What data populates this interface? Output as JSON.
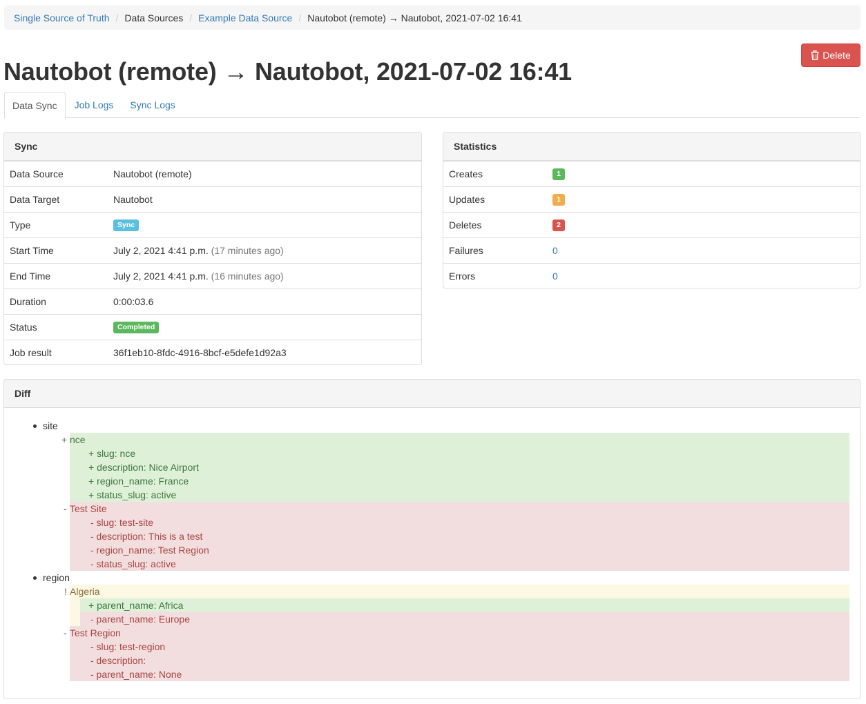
{
  "breadcrumb": {
    "items": [
      "Single Source of Truth",
      "Data Sources",
      "Example Data Source",
      "Nautobot (remote) → Nautobot, 2021-07-02 16:41"
    ]
  },
  "title": "Nautobot (remote) → Nautobot, 2021-07-02 16:41",
  "delete_button": {
    "label": "Delete",
    "icon": "trash-icon"
  },
  "tabs": [
    {
      "label": "Data Sync",
      "active": true
    },
    {
      "label": "Job Logs",
      "active": false
    },
    {
      "label": "Sync Logs",
      "active": false
    }
  ],
  "sync_panel": {
    "heading": "Sync",
    "rows": {
      "data_source": {
        "label": "Data Source",
        "value": "Nautobot (remote)"
      },
      "data_target": {
        "label": "Data Target",
        "value": "Nautobot"
      },
      "type": {
        "label": "Type",
        "value": "Sync"
      },
      "start_time": {
        "label": "Start Time",
        "value": "July 2, 2021 4:41 p.m.",
        "relative": "(17 minutes ago)"
      },
      "end_time": {
        "label": "End Time",
        "value": "July 2, 2021 4:41 p.m.",
        "relative": "(16 minutes ago)"
      },
      "duration": {
        "label": "Duration",
        "value": "0:00:03.6"
      },
      "status": {
        "label": "Status",
        "value": "Completed"
      },
      "job_result": {
        "label": "Job result",
        "value": "36f1eb10-8fdc-4916-8bcf-e5defe1d92a3"
      }
    }
  },
  "stats_panel": {
    "heading": "Statistics",
    "rows": {
      "creates": {
        "label": "Creates",
        "value": "1"
      },
      "updates": {
        "label": "Updates",
        "value": "1"
      },
      "deletes": {
        "label": "Deletes",
        "value": "2"
      },
      "failures": {
        "label": "Failures",
        "value": "0"
      },
      "errors": {
        "label": "Errors",
        "value": "0"
      }
    }
  },
  "diff_panel": {
    "heading": "Diff",
    "lines": {
      "site": "site",
      "nce_mark": "+",
      "nce": "nce",
      "nce_slug": "+ slug: nce",
      "nce_description": "+ description: Nice Airport",
      "nce_region": "+ region_name: France",
      "nce_status": "+ status_slug: active",
      "test_site_mark": "-",
      "test_site": "Test Site",
      "ts_slug": "- slug: test-site",
      "ts_description": "- description: This is a test",
      "ts_region": "- region_name: Test Region",
      "ts_status": "- status_slug: active",
      "region": "region",
      "algeria_mark": "!",
      "algeria": "Algeria",
      "alg_parent_add": "+ parent_name: Africa",
      "alg_parent_del": "- parent_name: Europe",
      "test_region_mark": "-",
      "test_region": "Test Region",
      "tr_slug": "- slug: test-region",
      "tr_description": "- description:",
      "tr_parent": "- parent_name: None"
    }
  },
  "colors": {
    "link": "#337ab7",
    "danger": "#d9534f",
    "success": "#5cb85c",
    "warning": "#f0ad4e",
    "info": "#5bc0de",
    "diff_add_bg": "#dff0d8",
    "diff_del_bg": "#f2dede",
    "diff_change_bg": "#fcf8e3"
  }
}
